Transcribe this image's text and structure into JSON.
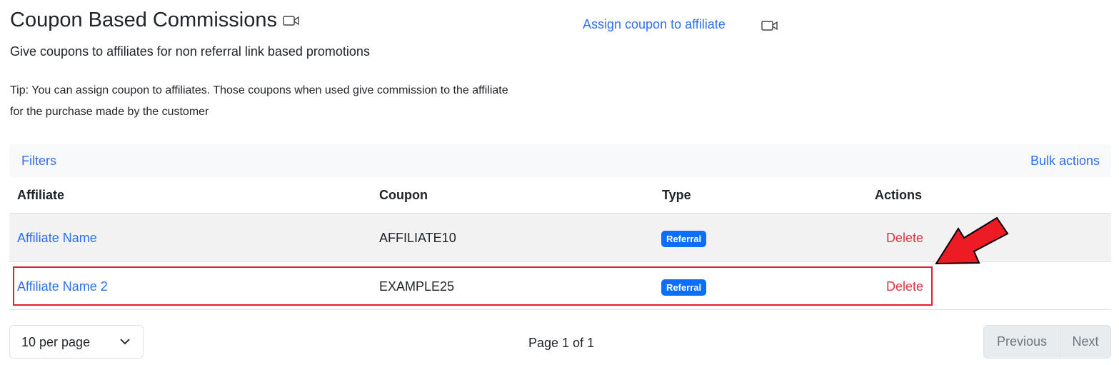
{
  "header": {
    "title": "Coupon Based Commissions",
    "subtitle": "Give coupons to affiliates for non referral link based promotions",
    "tip": "Tip: You can assign coupon to affiliates. Those coupons when used give commission to the affiliate for the purchase made by the customer",
    "assign_link": "Assign coupon to affiliate"
  },
  "toolbar": {
    "filters": "Filters",
    "bulk_actions": "Bulk actions"
  },
  "table": {
    "columns": [
      "Affiliate",
      "Coupon",
      "Type",
      "Actions"
    ],
    "rows": [
      {
        "affiliate": "Affiliate Name",
        "coupon": "AFFILIATE10",
        "type": "Referral",
        "action": "Delete"
      },
      {
        "affiliate": "Affiliate Name 2",
        "coupon": "EXAMPLE25",
        "type": "Referral",
        "action": "Delete"
      }
    ]
  },
  "footer": {
    "per_page": "10 per page",
    "page_info": "Page 1 of 1",
    "previous": "Previous",
    "next": "Next"
  },
  "annotation": {
    "highlight_color": "#e0202a",
    "arrow_color": "#ed1c24"
  }
}
